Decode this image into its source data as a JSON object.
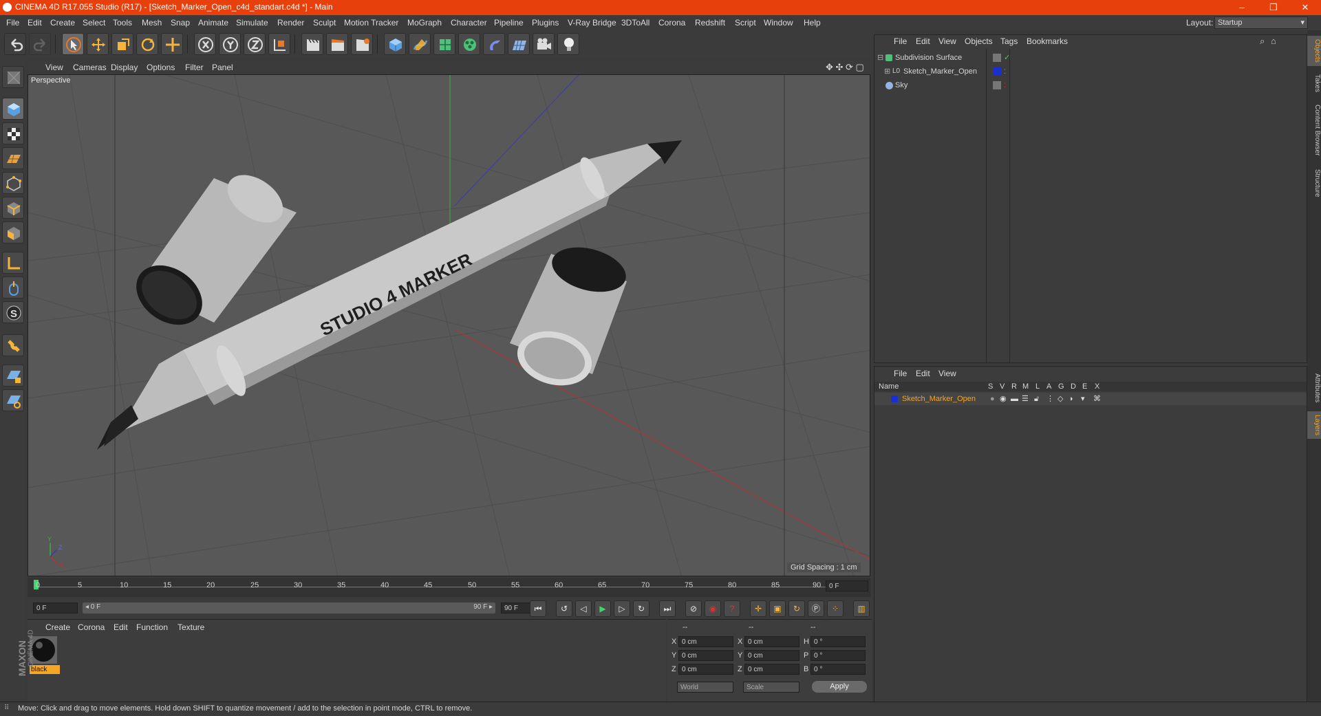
{
  "window": {
    "title": "CINEMA 4D R17.055 Studio (R17) - [Sketch_Marker_Open_c4d_standart.c4d *] - Main",
    "minimize": "–",
    "maximize": "❐",
    "close": "✕"
  },
  "menubar": {
    "items": [
      "File",
      "Edit",
      "Create",
      "Select",
      "Tools",
      "Mesh",
      "Snap",
      "Animate",
      "Simulate",
      "Render",
      "Sculpt",
      "Motion Tracker",
      "MoGraph",
      "Character",
      "Pipeline",
      "Plugins",
      "V-Ray Bridge",
      "3DToAll",
      "Corona",
      "Redshift",
      "Script",
      "Window",
      "Help"
    ],
    "layout_label": "Layout:",
    "layout_value": "Startup"
  },
  "viewport": {
    "menu": [
      "View",
      "Cameras",
      "Display",
      "Options",
      "Filter",
      "Panel"
    ],
    "label": "Perspective",
    "grid_spacing": "Grid Spacing : 1 cm",
    "model_text": "STUDIO 4 MARKER"
  },
  "timeline": {
    "ticks": [
      "0",
      "5",
      "10",
      "15",
      "20",
      "25",
      "30",
      "35",
      "40",
      "45",
      "50",
      "55",
      "60",
      "65",
      "70",
      "75",
      "80",
      "85",
      "90"
    ],
    "current_frame": "0 F",
    "start_field": "0 F",
    "range_start": "◂ 0 F",
    "range_end": "90 F ▸",
    "end_field": "90 F"
  },
  "material_manager": {
    "menu": [
      "Create",
      "Corona",
      "Edit",
      "Function",
      "Texture"
    ],
    "materials": [
      {
        "name": "black"
      }
    ],
    "brand": "MAXON",
    "brand_sub": "CINEMA 4D"
  },
  "coordinates": {
    "headers": [
      "--",
      "--",
      "--"
    ],
    "rows": [
      {
        "a": "X",
        "av": "0 cm",
        "b": "X",
        "bv": "0 cm",
        "c": "H",
        "cv": "0 °"
      },
      {
        "a": "Y",
        "av": "0 cm",
        "b": "Y",
        "bv": "0 cm",
        "c": "P",
        "cv": "0 °"
      },
      {
        "a": "Z",
        "av": "0 cm",
        "b": "Z",
        "bv": "0 cm",
        "c": "B",
        "cv": "0 °"
      }
    ],
    "mode": "World",
    "scale": "Scale",
    "apply": "Apply"
  },
  "object_manager": {
    "menu": [
      "File",
      "Edit",
      "View",
      "Objects",
      "Tags",
      "Bookmarks"
    ],
    "objects": [
      {
        "name": "Subdivision Surface"
      },
      {
        "name": "Sketch_Marker_Open"
      },
      {
        "name": "Sky"
      }
    ]
  },
  "layer_manager": {
    "menu": [
      "File",
      "Edit",
      "View"
    ],
    "columns": [
      "Name",
      "S",
      "V",
      "R",
      "M",
      "L",
      "A",
      "G",
      "D",
      "E",
      "X"
    ],
    "layers": [
      {
        "name": "Sketch_Marker_Open",
        "color": "#1a2fd0"
      }
    ]
  },
  "right_tabs": [
    "Objects",
    "Takes",
    "Content Browser",
    "Structure",
    "Attributes",
    "Layers"
  ],
  "status": "Move: Click and drag to move elements. Hold down SHIFT to quantize movement / add to the selection in point mode, CTRL to remove.",
  "colors": {
    "accent": "#e8400c",
    "selection_orange": "#f5a623",
    "layer_blue": "#1a2fd0"
  }
}
